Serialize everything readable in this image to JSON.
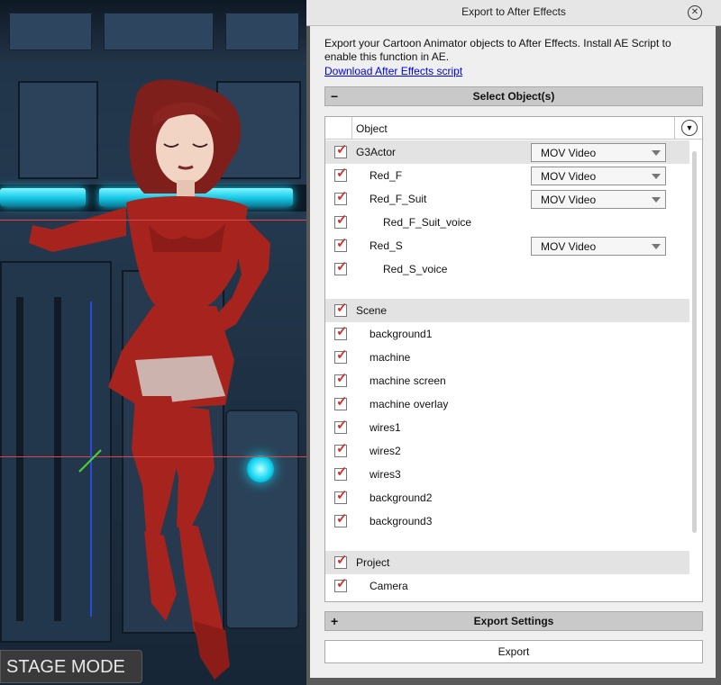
{
  "stage": {
    "mode_label": "STAGE MODE"
  },
  "dialog": {
    "title": "Export to After Effects",
    "description": "Export your Cartoon Animator objects to After Effects. Install AE Script to enable this function in AE.",
    "download_link": "Download After Effects script",
    "select_section": {
      "sign": "−",
      "label": "Select Object(s)"
    },
    "list_header": "Object",
    "items": [
      {
        "label": "G3Actor",
        "group": true,
        "format": "MOV Video"
      },
      {
        "label": "Red_F",
        "format": "MOV Video"
      },
      {
        "label": "Red_F_Suit",
        "format": "MOV Video"
      },
      {
        "label": "Red_F_Suit_voice"
      },
      {
        "label": "Red_S",
        "format": "MOV Video"
      },
      {
        "label": "Red_S_voice"
      },
      {
        "label": "Scene",
        "group": true
      },
      {
        "label": "background1"
      },
      {
        "label": "machine"
      },
      {
        "label": "machine screen"
      },
      {
        "label": "machine overlay"
      },
      {
        "label": "wires1"
      },
      {
        "label": "wires2"
      },
      {
        "label": "wires3"
      },
      {
        "label": "background2"
      },
      {
        "label": "background3"
      },
      {
        "label": "Project",
        "group": true
      },
      {
        "label": "Camera"
      }
    ],
    "export_settings": {
      "sign": "+",
      "label": "Export Settings"
    },
    "export_button": "Export",
    "close_icon": "close-icon",
    "check_color": "#d42f2f"
  }
}
